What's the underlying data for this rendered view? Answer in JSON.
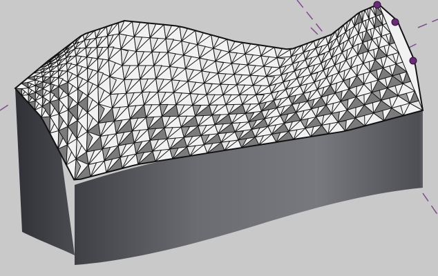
{
  "viewport": {
    "background_color": "#c9c9c9",
    "model": {
      "side_color": "#5f6167",
      "panel_light_color": "#f2f2f2",
      "panel_dark_color": "#7b7b7b",
      "grid_line_color": "#141414",
      "control_point_color": "#6a2a7a",
      "axis_line_color": "#7d4b8c",
      "control_points": [
        "control-point",
        "control-point",
        "control-point"
      ]
    }
  }
}
